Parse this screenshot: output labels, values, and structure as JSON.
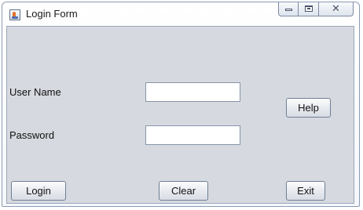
{
  "window": {
    "title": "Login Form",
    "app_icon": "java-cup-icon",
    "controls": {
      "minimize_icon": "minimize-icon",
      "maximize_icon": "maximize-icon",
      "close_icon": "close-icon",
      "close_glyph": "✕"
    }
  },
  "form": {
    "username_label": "User Name",
    "username_value": "",
    "password_label": "Password",
    "password_value": ""
  },
  "buttons": {
    "help": "Help",
    "login": "Login",
    "clear": "Clear",
    "exit": "Exit"
  },
  "colors": {
    "client_background": "#d6d9df",
    "field_background": "#ffffff"
  }
}
